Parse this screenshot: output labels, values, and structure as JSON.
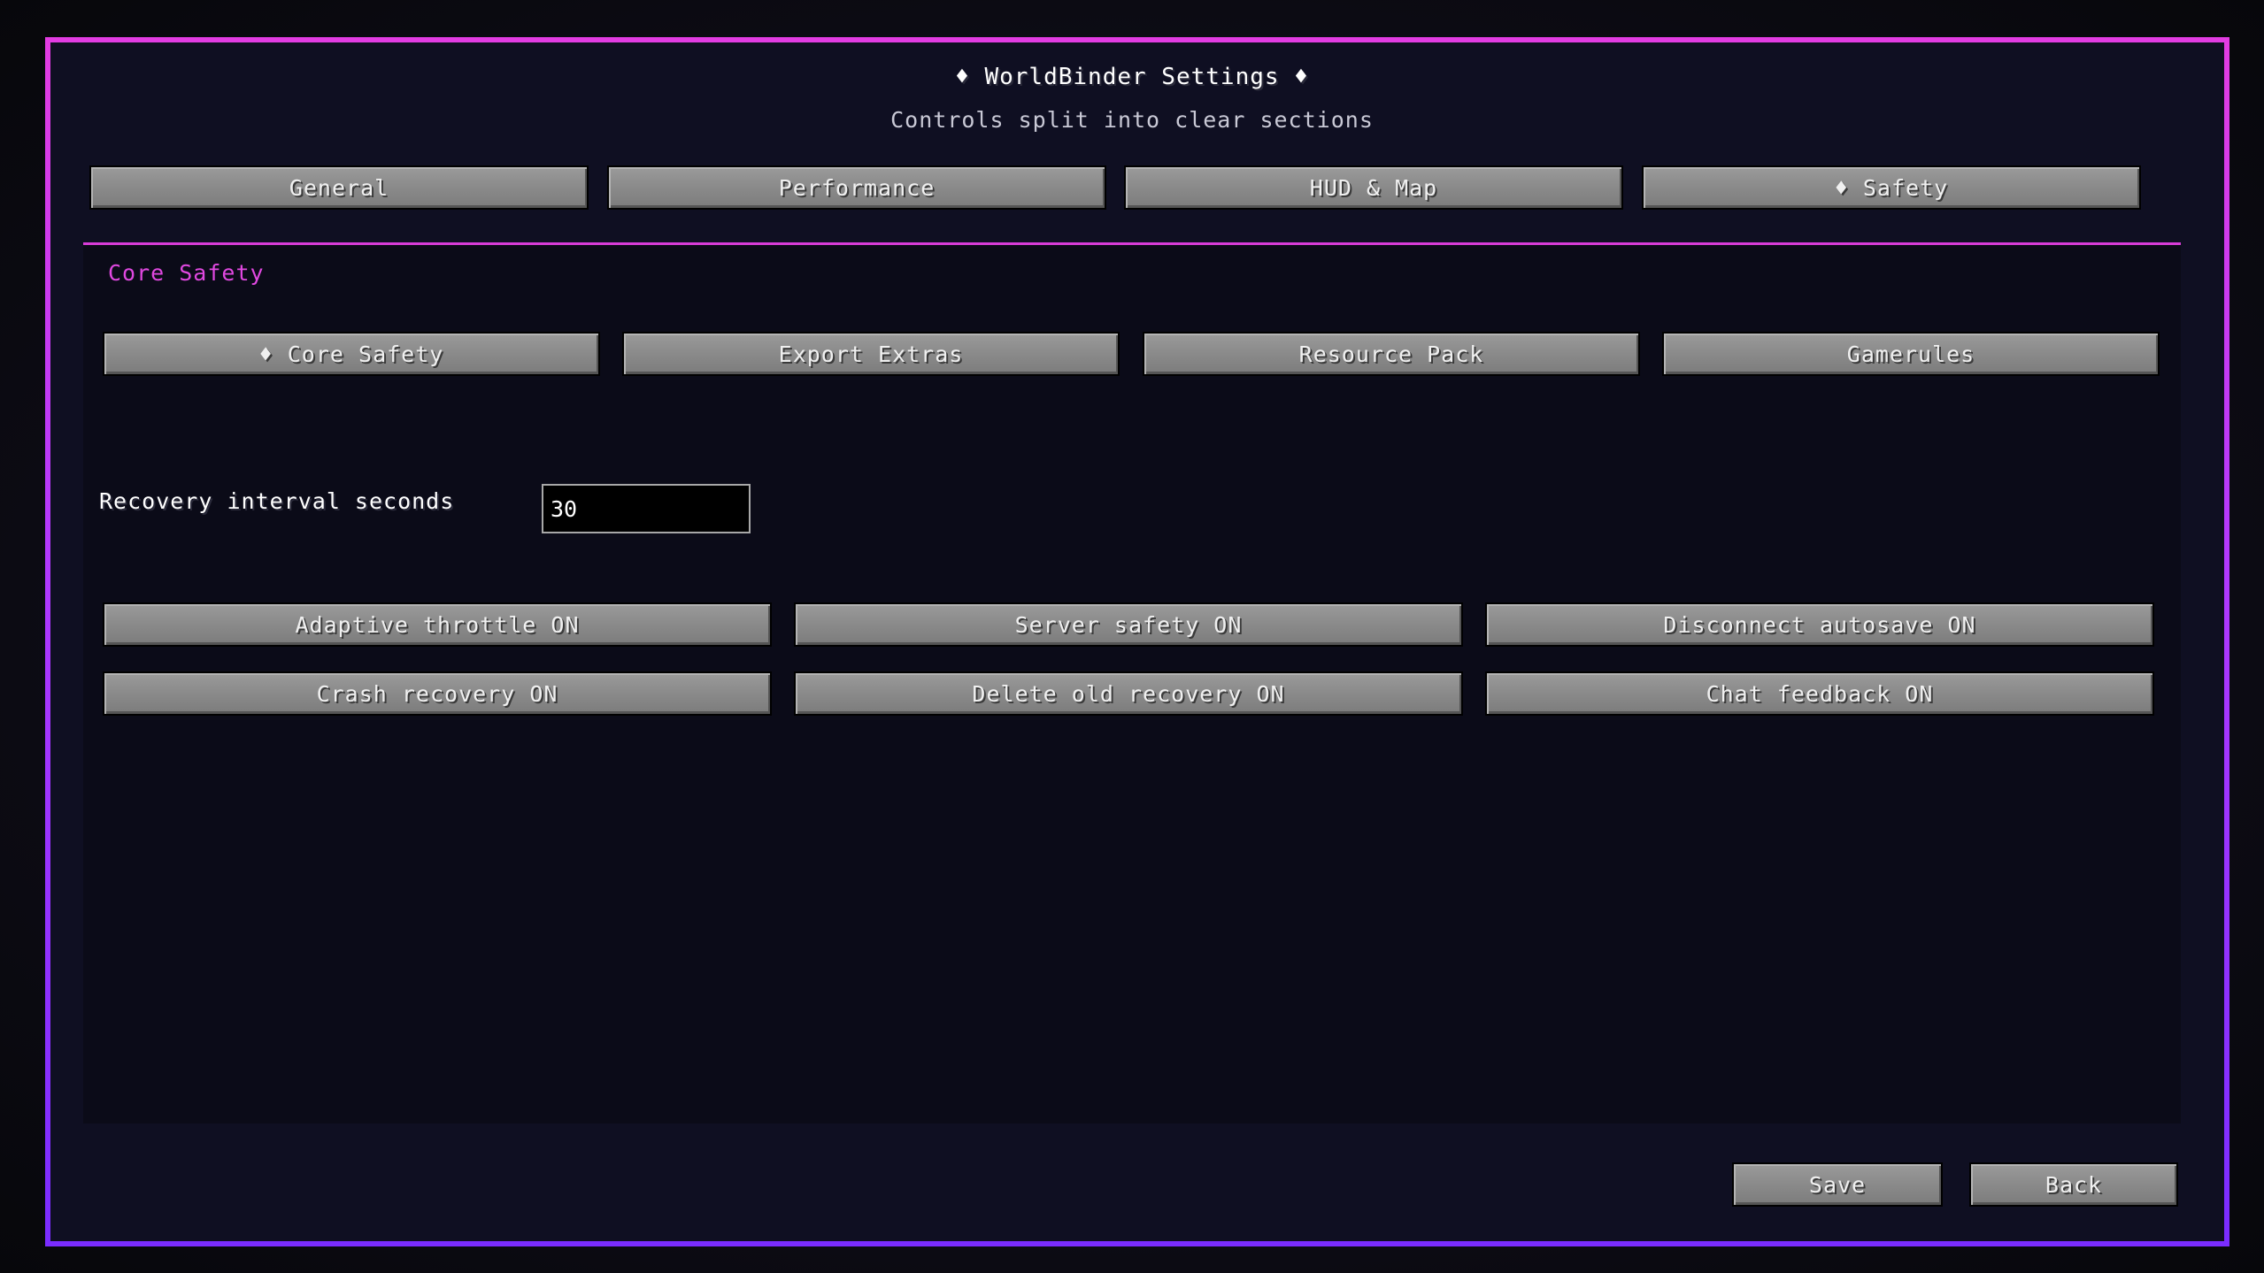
{
  "header": {
    "title": "♦ WorldBinder Settings ♦",
    "subtitle": "Controls split into clear sections"
  },
  "tabs": [
    {
      "label": "General",
      "selected": false
    },
    {
      "label": "Performance",
      "selected": false
    },
    {
      "label": "HUD & Map",
      "selected": false
    },
    {
      "label": "♦ Safety",
      "selected": true
    }
  ],
  "section": {
    "label": "Core Safety"
  },
  "subtabs": [
    {
      "label": "♦ Core Safety",
      "selected": true
    },
    {
      "label": "Export Extras",
      "selected": false
    },
    {
      "label": "Resource Pack",
      "selected": false
    },
    {
      "label": "Gamerules",
      "selected": false
    }
  ],
  "recovery_interval": {
    "label": "Recovery interval seconds",
    "value": "30"
  },
  "toggles": [
    {
      "label": "Adaptive throttle ON"
    },
    {
      "label": "Server safety ON"
    },
    {
      "label": "Disconnect autosave ON"
    },
    {
      "label": "Crash recovery ON"
    },
    {
      "label": "Delete old recovery ON"
    },
    {
      "label": "Chat feedback ON"
    }
  ],
  "footer": {
    "save_label": "Save",
    "back_label": "Back"
  },
  "colors": {
    "accent": "#e048e0",
    "frame_top": "#e23ce2",
    "frame_bottom": "#7a2cff",
    "panel": "#0f0f22"
  }
}
